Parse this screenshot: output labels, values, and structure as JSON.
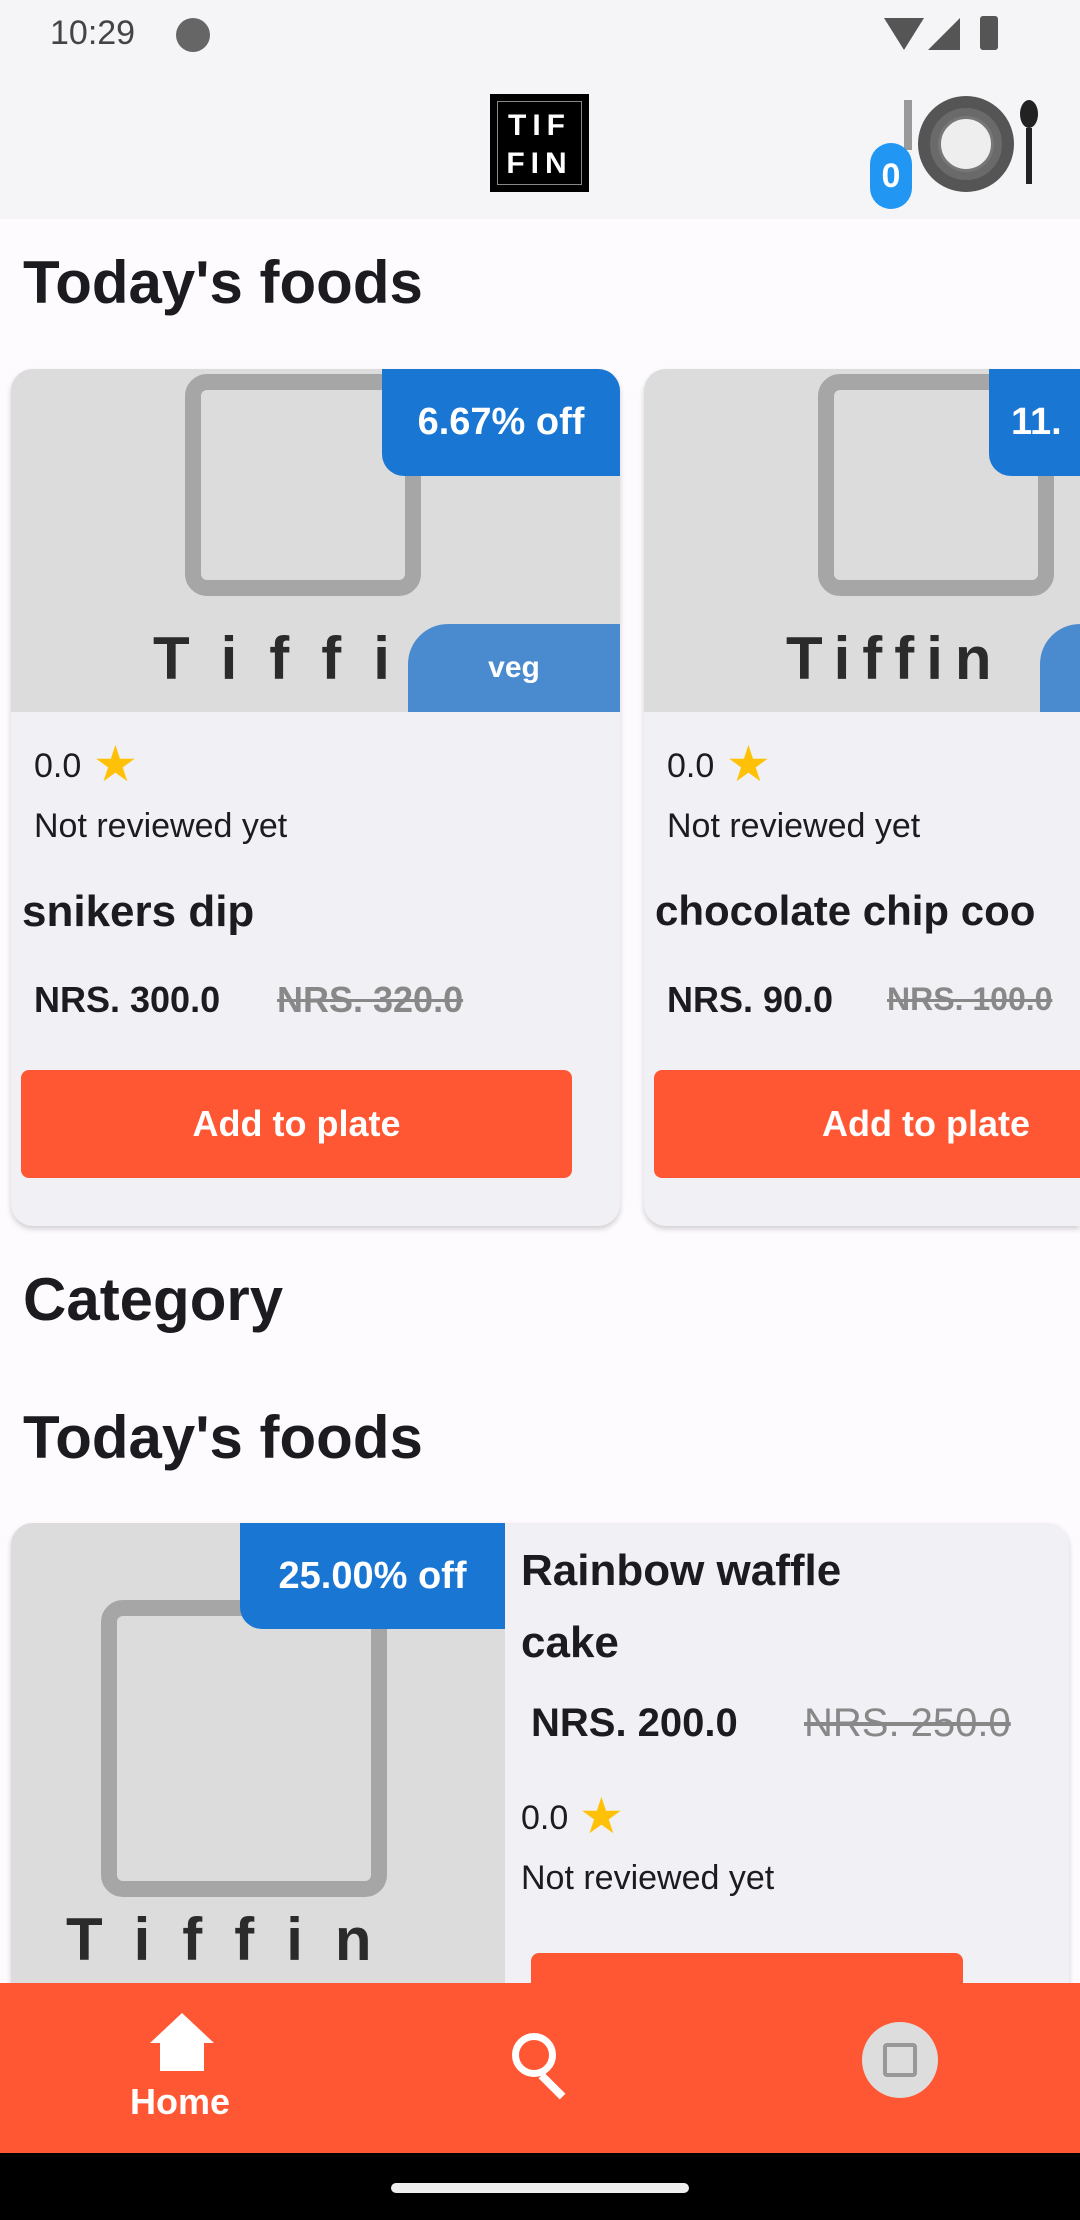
{
  "status_bar": {
    "time": "10:29"
  },
  "header": {
    "logo_lines": [
      "TIF",
      "FIN"
    ],
    "cart_count": "0"
  },
  "sections": {
    "todays_foods": "Today's foods",
    "category": "Category",
    "todays_foods_2": "Today's foods"
  },
  "placeholder_text": "Tiffin",
  "carousel": [
    {
      "name": "snikers dip",
      "discount": "6.67% off",
      "tag": "veg",
      "rating": "0.0",
      "review": "Not reviewed yet",
      "price": "NRS. 300.0",
      "old_price": "NRS. 320.0",
      "button": "Add to plate"
    },
    {
      "name": "chocolate chip coo",
      "discount": "11.",
      "tag": "",
      "rating": "0.0",
      "review": "Not reviewed yet",
      "price": "NRS. 90.0",
      "old_price": "NRS. 100.0",
      "button": "Add to plate"
    }
  ],
  "list": [
    {
      "name": "Rainbow waffle cake",
      "discount": "25.00% off",
      "rating": "0.0",
      "review": "Not reviewed yet",
      "price": "NRS. 200.0",
      "old_price": "NRS. 250.0"
    }
  ],
  "bottom_nav": {
    "items": [
      {
        "label": "Home",
        "icon": "home-icon",
        "active": true
      },
      {
        "label": "",
        "icon": "search-icon"
      },
      {
        "label": "",
        "icon": "profile-avatar"
      }
    ]
  },
  "colors": {
    "accent": "#ff5733",
    "badge": "#1976d2",
    "veg": "#4a8bd0",
    "star": "#ffc107"
  }
}
